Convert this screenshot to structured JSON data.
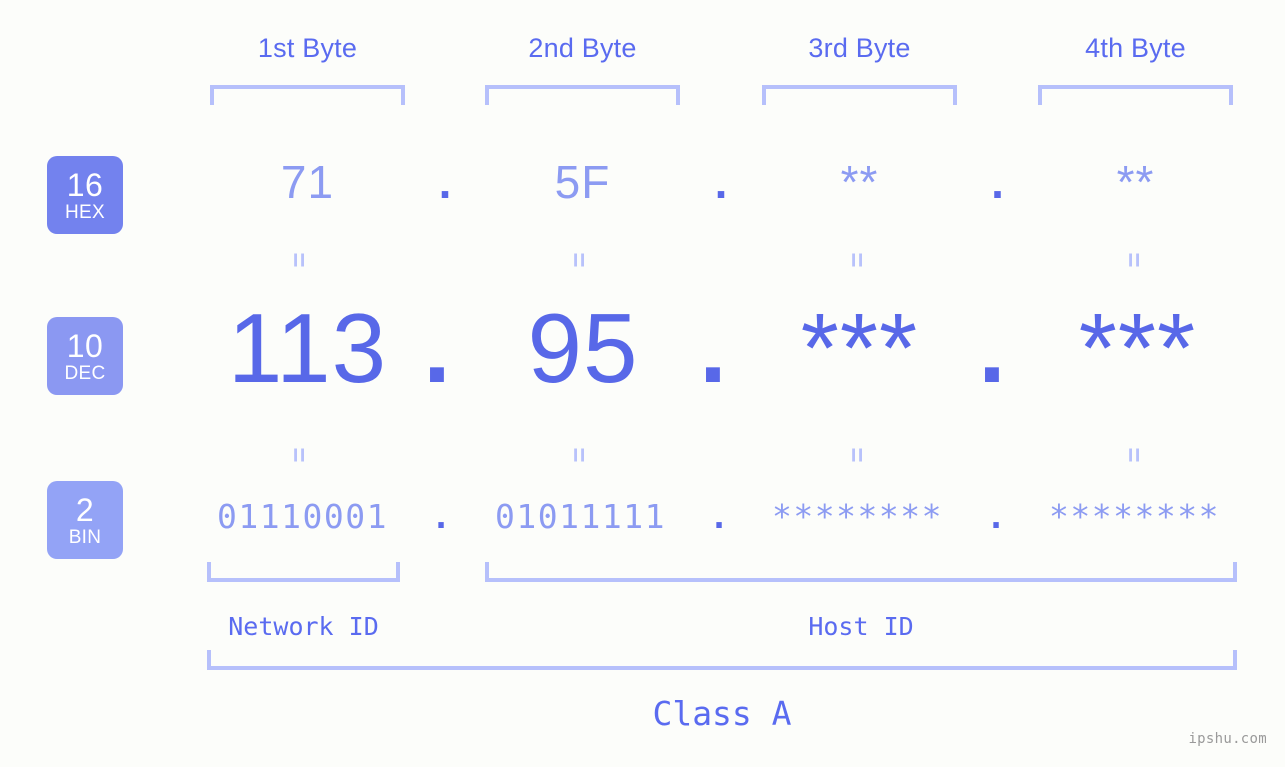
{
  "background_color": "#fcfdfa",
  "colors": {
    "header_blue": "#5a6bf0",
    "bracket_blue": "#b6c0fb",
    "value_light_blue": "#8c9bf2",
    "value_strong_blue": "#5868e8",
    "badge_hex": "#7382ee",
    "badge_dec": "#8b98f2",
    "badge_bin": "#93a3f6",
    "watermark_gray": "#9a9a9a"
  },
  "byte_headers": [
    {
      "label": "1st Byte"
    },
    {
      "label": "2nd Byte"
    },
    {
      "label": "3rd Byte"
    },
    {
      "label": "4th Byte"
    }
  ],
  "bases": [
    {
      "number": "16",
      "abbr": "HEX"
    },
    {
      "number": "10",
      "abbr": "DEC"
    },
    {
      "number": "2",
      "abbr": "BIN"
    }
  ],
  "rows": {
    "hex": {
      "base_number": "16",
      "base_abbr": "HEX",
      "values": [
        "71",
        "5F",
        "**",
        "**"
      ],
      "separators": [
        ".",
        ".",
        "."
      ]
    },
    "dec": {
      "base_number": "10",
      "base_abbr": "DEC",
      "values": [
        "113",
        "95",
        "***",
        "***"
      ],
      "separators": [
        ".",
        ".",
        "."
      ]
    },
    "bin": {
      "base_number": "2",
      "base_abbr": "BIN",
      "values": [
        "01110001",
        "01011111",
        "********",
        "********"
      ],
      "separators": [
        ".",
        ".",
        "."
      ]
    }
  },
  "equals_markers": {
    "symbol": "=",
    "row1_count": 4,
    "row2_count": 4
  },
  "id_sections": [
    {
      "label": "Network ID"
    },
    {
      "label": "Host ID"
    }
  ],
  "class_label": "Class A",
  "watermark": "ipshu.com"
}
